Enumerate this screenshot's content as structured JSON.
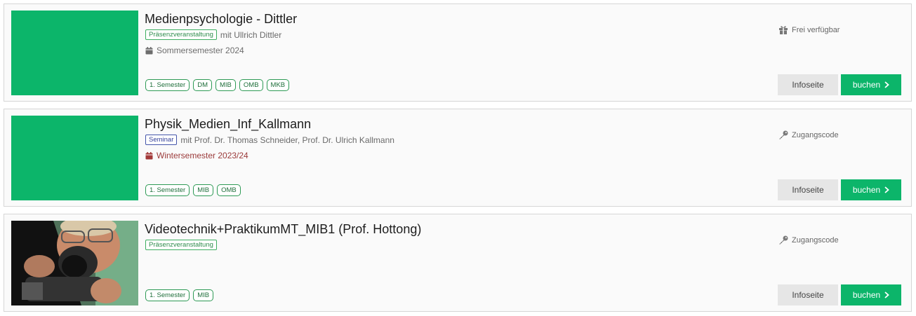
{
  "courses": [
    {
      "title": "Medienpsychologie - Dittler",
      "type_badge": "Präsenzveranstaltung",
      "teacher": "mit Ullrich Dittler",
      "semester": "Sommersemester 2024",
      "tags": [
        "1. Semester",
        "DM",
        "MIB",
        "OMB",
        "MKB"
      ],
      "availability": "Frei verfügbar",
      "availability_icon": "gift-icon",
      "info_label": "Infoseite",
      "book_label": "buchen",
      "thumb_color": "#0cb56a"
    },
    {
      "title": "Physik_Medien_Inf_Kallmann",
      "type_badge": "Seminar",
      "teacher": "mit Prof. Dr. Thomas Schneider, Prof. Dr. Ulrich Kallmann",
      "semester": "Wintersemester 2023/24",
      "tags": [
        "1. Semester",
        "MIB",
        "OMB"
      ],
      "availability": "Zugangscode",
      "availability_icon": "key-icon",
      "info_label": "Infoseite",
      "book_label": "buchen",
      "thumb_color": "#0cb56a"
    },
    {
      "title": "Videotechnik+PraktikumMT_MIB1 (Prof. Hottong)",
      "type_badge": "Präsenzveranstaltung",
      "teacher": "",
      "semester": "",
      "tags": [
        "1. Semester",
        "MIB"
      ],
      "availability": "Zugangscode",
      "availability_icon": "key-icon",
      "info_label": "Infoseite",
      "book_label": "buchen",
      "thumb_image": "photo of a person looking through a camera"
    }
  ],
  "colors": {
    "accent": "#0cb56a",
    "tag_border": "#2e9a55",
    "seminar_badge": "#34419a",
    "winter_semester": "#9b3a3a"
  }
}
